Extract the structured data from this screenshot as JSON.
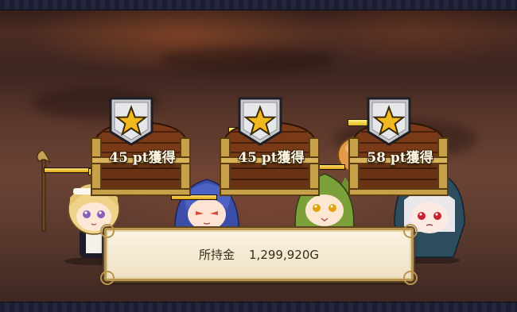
{
  "rewards": [
    {
      "points_label": "45 pt獲得",
      "medal": "star-medal-icon"
    },
    {
      "points_label": "45 pt獲得",
      "medal": "star-medal-icon"
    },
    {
      "points_label": "58 pt獲得",
      "medal": "star-medal-icon"
    }
  ],
  "money": {
    "label": "所持金",
    "value": "1,299,920G"
  },
  "colors": {
    "frame": "#1b1d30",
    "panel_bg": "#f6ead2",
    "panel_border": "#b99550",
    "pt_text": "#fdf7e6",
    "gauge": "#f3d84a"
  },
  "characters": [
    "maid-girl",
    "blue-haired-girl",
    "green-haired-girl",
    "white-haired-hooded-girl"
  ]
}
